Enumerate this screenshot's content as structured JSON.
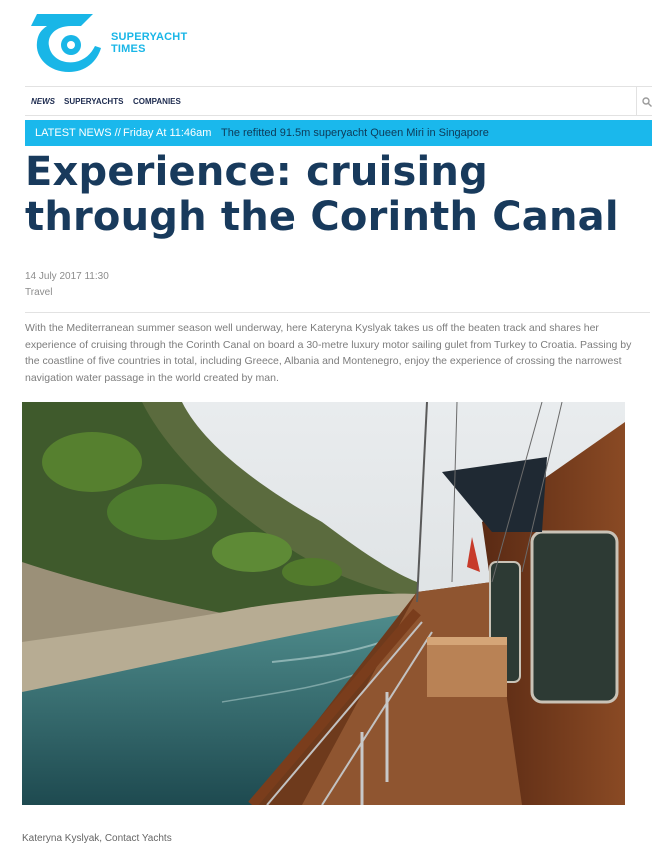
{
  "brand": {
    "line1": "SUPERYACHT",
    "line2": "TIMES",
    "color": "#19b6e7"
  },
  "nav": {
    "items": [
      {
        "label": "NEWS",
        "active": true
      },
      {
        "label": "SUPERYACHTS",
        "active": false
      },
      {
        "label": "COMPANIES",
        "active": false
      }
    ],
    "search_icon": "search-icon"
  },
  "ticker": {
    "label": "LATEST NEWS //",
    "time": "Friday At 11:46am",
    "headline": "The refitted 91.5m superyacht Queen Miri in Singapore",
    "bg_color": "#1ab8ec"
  },
  "article": {
    "title": "Experience: cruising through the Corinth Canal",
    "date": "14 July 2017 11:30",
    "category": "Travel",
    "intro": "With the Mediterranean summer season well underway, here Kateryna Kyslyak takes us off the beaten track and shares her experience of cruising through the Corinth Canal on board a 30-metre luxury motor sailing gulet from Turkey to Croatia. Passing by the coastline of five countries in total, including Greece, Albania and Montenegro, enjoy the experience of crossing the narrowest navigation water passage in the world created by man.",
    "image_caption": "Kateryna Kyslyak, Contact Yachts"
  }
}
